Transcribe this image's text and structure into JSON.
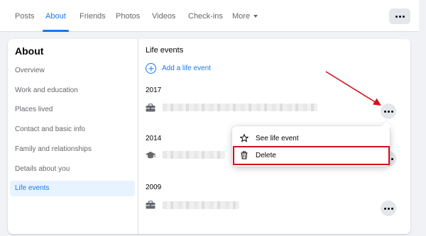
{
  "tabs": [
    {
      "label": "Posts",
      "active": false
    },
    {
      "label": "About",
      "active": true
    },
    {
      "label": "Friends",
      "active": false
    },
    {
      "label": "Photos",
      "active": false
    },
    {
      "label": "Videos",
      "active": false
    },
    {
      "label": "Check-ins",
      "active": false
    },
    {
      "label": "More",
      "active": false
    }
  ],
  "about": {
    "title": "About",
    "items": [
      {
        "label": "Overview"
      },
      {
        "label": "Work and education"
      },
      {
        "label": "Places lived"
      },
      {
        "label": "Contact and basic info"
      },
      {
        "label": "Family and relationships"
      },
      {
        "label": "Details about you"
      },
      {
        "label": "Life events",
        "active": true
      }
    ]
  },
  "life_events": {
    "title": "Life events",
    "add_label": "Add a life event",
    "years": [
      {
        "year": "2017",
        "icon": "briefcase-icon"
      },
      {
        "year": "2014",
        "icon": "graduation-cap-icon"
      },
      {
        "year": "2009",
        "icon": "briefcase-icon"
      }
    ]
  },
  "menu": {
    "items": [
      {
        "label": "See life event",
        "icon": "star-icon"
      },
      {
        "label": "Delete",
        "icon": "trash-icon",
        "highlighted": true
      }
    ]
  },
  "colors": {
    "accent": "#1877f2",
    "annotation": "#d4101a",
    "background": "#f0f2f5"
  }
}
